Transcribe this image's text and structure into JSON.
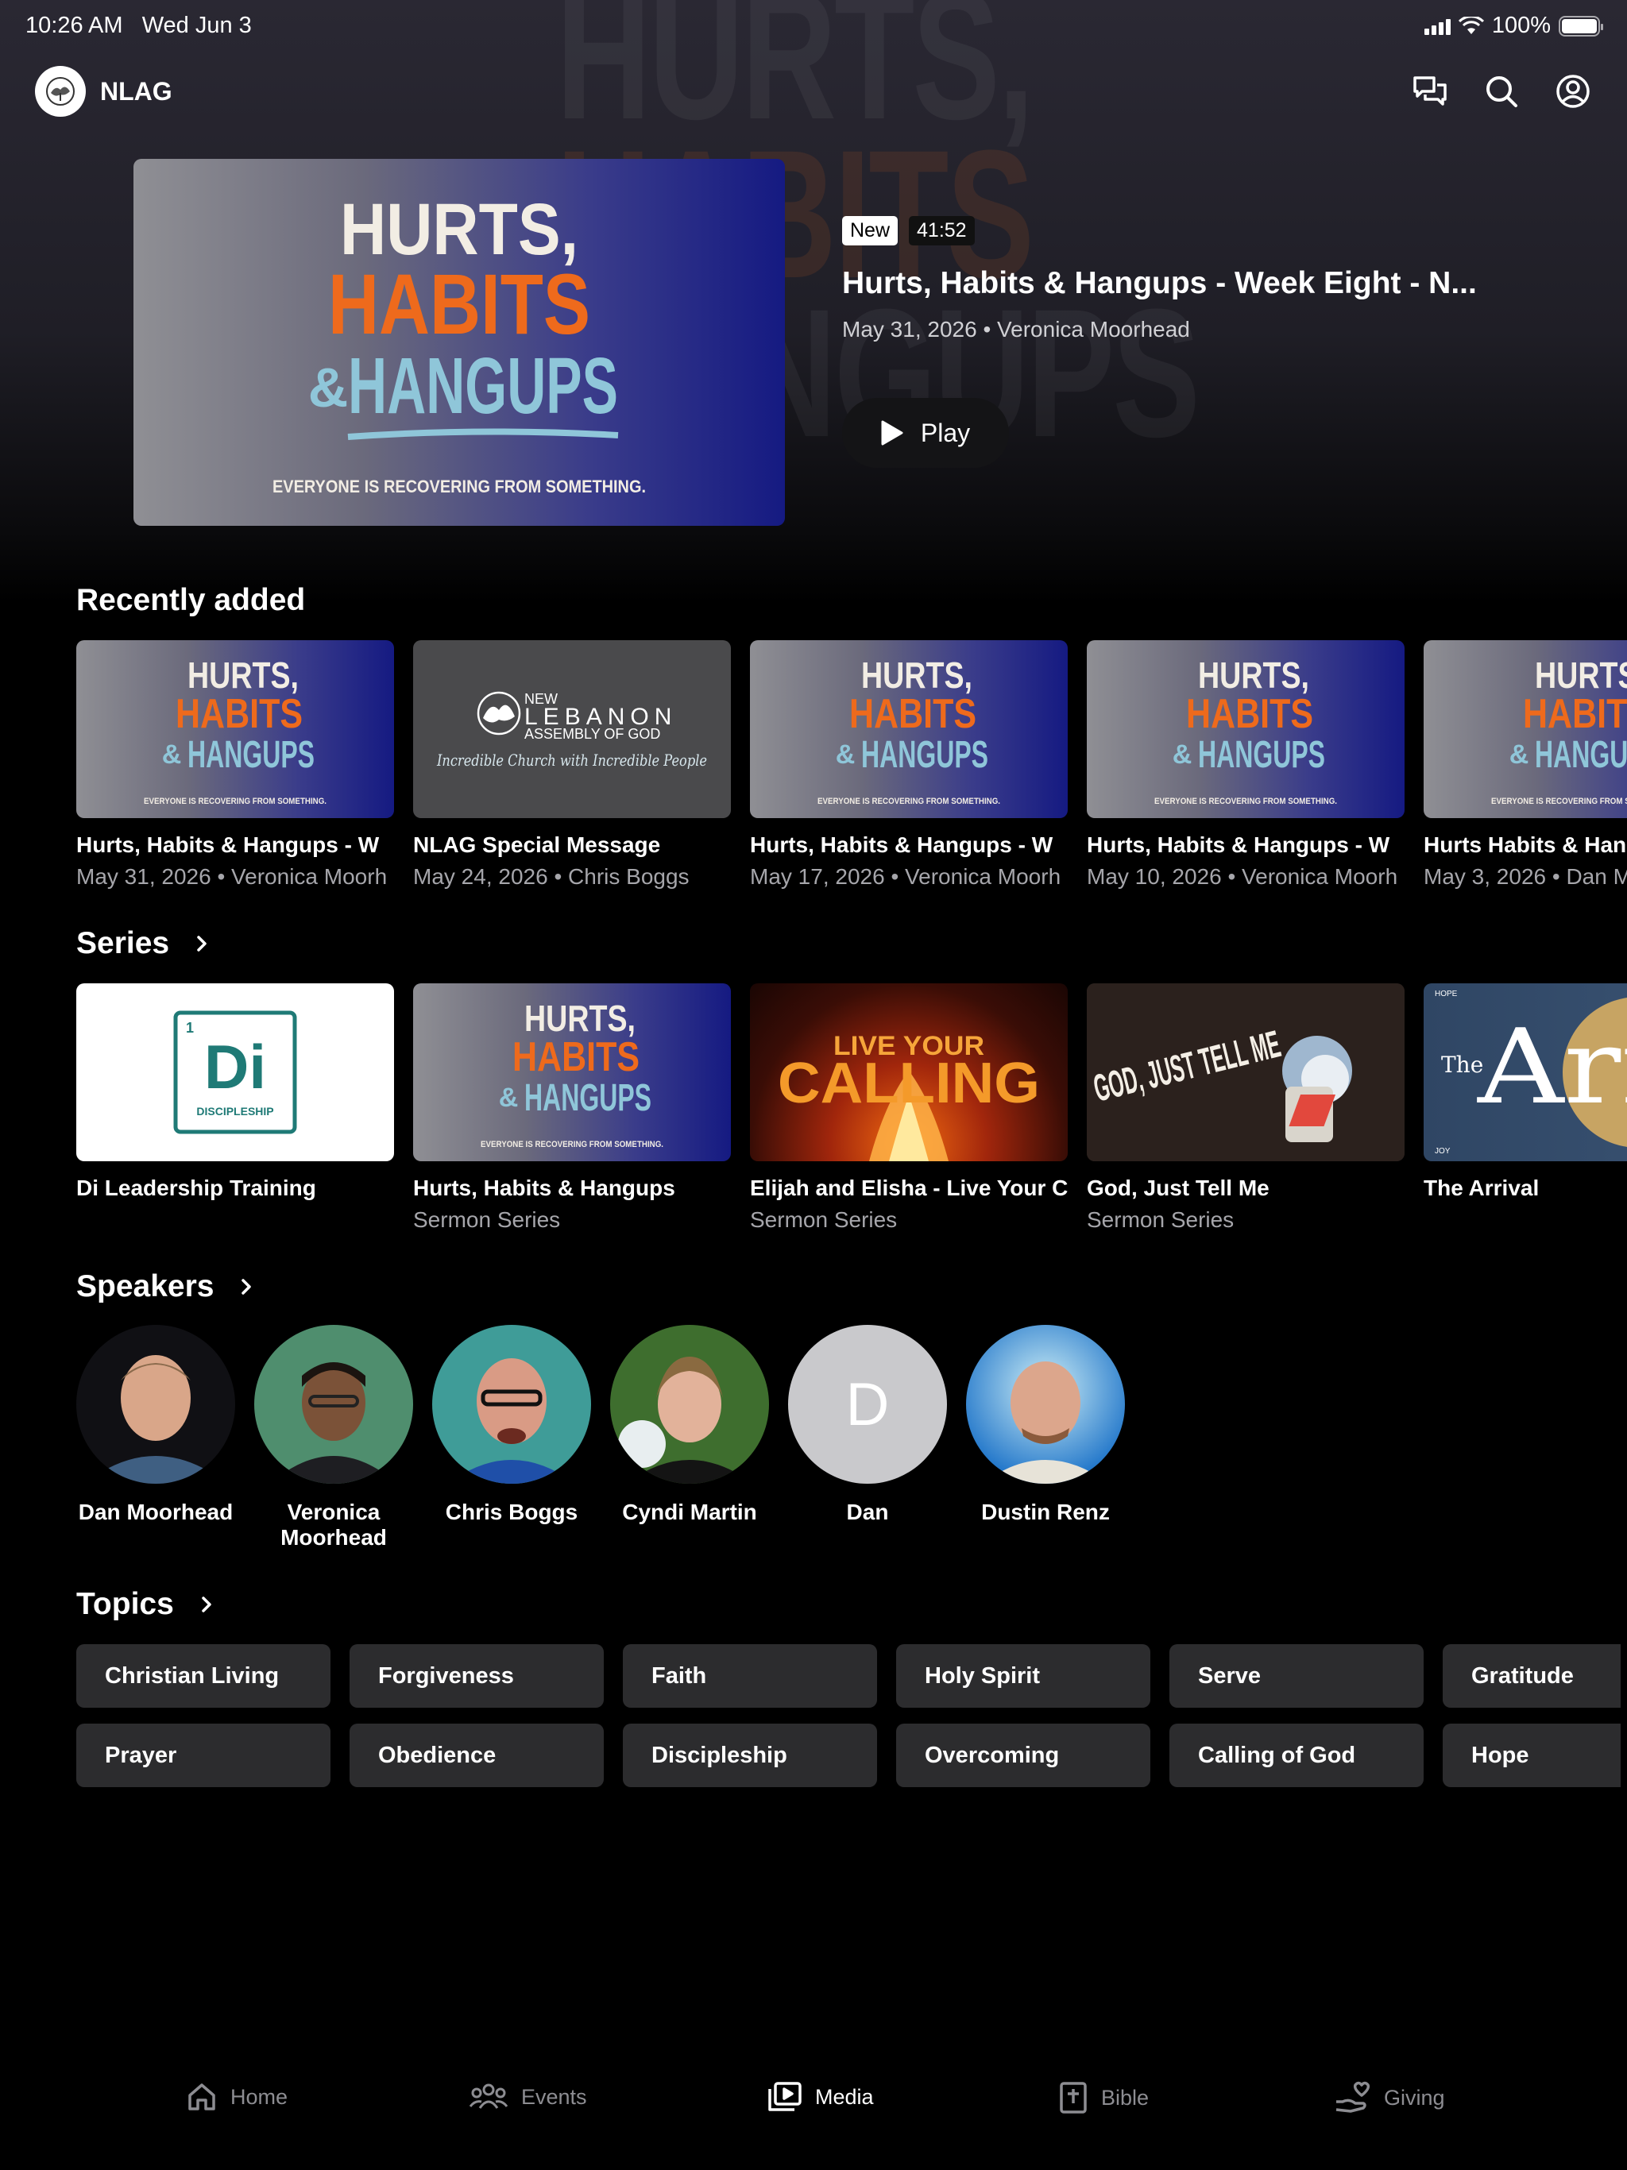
{
  "status_bar": {
    "time": "10:26 AM",
    "date": "Wed Jun 3",
    "battery": "100%"
  },
  "header": {
    "app_name": "NLAG"
  },
  "hero": {
    "art": {
      "line1": "HURTS,",
      "line2": "HABITS",
      "amp": "&",
      "line3": "HANGUPS",
      "tagline": "EVERYONE IS RECOVERING FROM SOMETHING."
    },
    "badge_new": "New",
    "duration": "41:52",
    "title": "Hurts, Habits & Hangups - Week Eight - N...",
    "meta": "May 31, 2026 • Veronica Moorhead",
    "play_label": "Play"
  },
  "recently_added": {
    "title": "Recently added",
    "items": [
      {
        "title": "Hurts, Habits & Hangups - W",
        "meta": "May 31, 2026 • Veronica Moorh"
      },
      {
        "title": "NLAG Special Message",
        "meta": "May 24, 2026 • Chris Boggs"
      },
      {
        "title": "Hurts, Habits & Hangups - W",
        "meta": "May 17, 2026 • Veronica Moorh"
      },
      {
        "title": "Hurts, Habits & Hangups - W",
        "meta": "May 10, 2026 • Veronica Moorh"
      },
      {
        "title": "Hurts Habits & Han",
        "meta": "May 3, 2026 • Dan M"
      }
    ],
    "nlag_art": {
      "new": "NEW",
      "name": "LEBANON",
      "sub": "ASSEMBLY OF GOD",
      "script": "Incredible Church with Incredible People"
    }
  },
  "series": {
    "title": "Series",
    "items": [
      {
        "title": "Di Leadership Training",
        "subtitle": ""
      },
      {
        "title": "Hurts, Habits & Hangups",
        "subtitle": "Sermon Series"
      },
      {
        "title": "Elijah and Elisha - Live Your C",
        "subtitle": "Sermon Series"
      },
      {
        "title": "God, Just Tell Me",
        "subtitle": "Sermon Series"
      },
      {
        "title": "The Arrival",
        "subtitle": ""
      }
    ],
    "di_art": {
      "num": "1",
      "symbol": "Di",
      "label": "DISCIPLESHIP"
    },
    "calling_art": {
      "line1": "LIVE YOUR",
      "line2": "CALLING"
    },
    "god_art": {
      "text": "GOD, JUST TELL ME"
    },
    "arrival_art": {
      "the": "The",
      "word": "Arri",
      "hope": "HOPE",
      "joy": "JOY"
    }
  },
  "speakers": {
    "title": "Speakers",
    "items": [
      {
        "name": "Dan Moorhead",
        "initial": ""
      },
      {
        "name": "Veronica Moorhead",
        "initial": ""
      },
      {
        "name": "Chris Boggs",
        "initial": ""
      },
      {
        "name": "Cyndi Martin",
        "initial": ""
      },
      {
        "name": "Dan",
        "initial": "D"
      },
      {
        "name": "Dustin Renz",
        "initial": ""
      }
    ]
  },
  "topics": {
    "title": "Topics",
    "items": [
      "Christian Living",
      "Forgiveness",
      "Faith",
      "Holy Spirit",
      "Serve",
      "Gratitude",
      "Prayer",
      "Obedience",
      "Discipleship",
      "Overcoming",
      "Calling of God",
      "Hope"
    ]
  },
  "tabbar": {
    "items": [
      {
        "label": "Home",
        "icon": "home-icon"
      },
      {
        "label": "Events",
        "icon": "people-icon"
      },
      {
        "label": "Media",
        "icon": "media-icon",
        "active": true
      },
      {
        "label": "Bible",
        "icon": "bible-icon"
      },
      {
        "label": "Giving",
        "icon": "giving-icon"
      }
    ]
  },
  "colors": {
    "background": "#000000",
    "chip": "#2c2c2e",
    "accent_orange": "#ee6a1c",
    "accent_blue": "#8fc6d9"
  }
}
